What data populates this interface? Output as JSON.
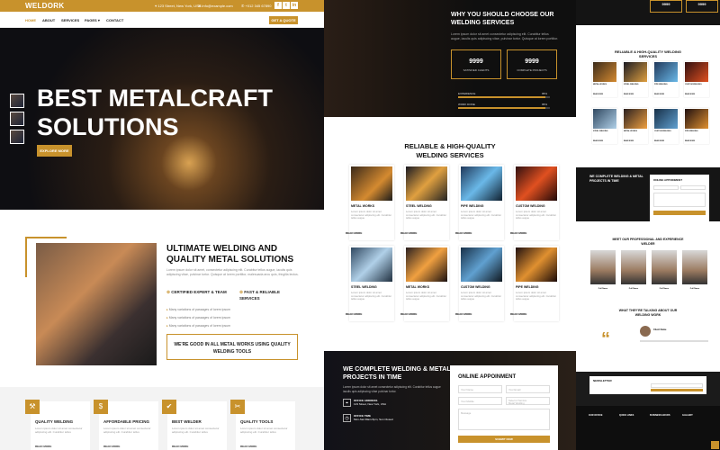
{
  "brand": {
    "name": "WELDORK",
    "accent": "#c8922c"
  },
  "topbar": {
    "address": "123 Street, New York, USA",
    "email": "info@example.com",
    "phone": "+012 345 67890",
    "social": [
      "f",
      "t",
      "in"
    ]
  },
  "nav": {
    "items": [
      "HOME",
      "ABOUT",
      "SERVICES",
      "PAGES",
      "CONTACT"
    ],
    "quote": "GET A QUOTE"
  },
  "hero": {
    "title": "BEST METALCRAFT SOLUTIONS",
    "button": "EXPLORE MORE"
  },
  "about": {
    "title": "ULTIMATE WELDING AND QUALITY METAL SOLUTIONS",
    "text": "Lorem ipsum dolor sit amet, consectetur adipiscing elit. Curabitur tellus augue, iaculis quis adipiscing vitae, pulvinar tortor. Quisque at lorem porttitor, malesuada arcu quis, fringilla lectus.",
    "features": [
      "CERTIFIED EXPERT & TEAM",
      "FAST & RELIABLE SERVICES"
    ],
    "bullets": [
      "Many variations of passages of lorem ipsum",
      "Many variations of passages of lorem ipsum",
      "Many variations of passages of lorem ipsum"
    ],
    "good": "WE'RE GOOD IN ALL METAL WORKS USING QUALITY WELDING TOOLS"
  },
  "services_strip": [
    {
      "icon": "hammer-icon",
      "glyph": "⚒",
      "title": "QUALITY WELDING",
      "desc": "Lorem ipsum dolor sit amet consectetur adipiscing elit. Curabitur tellus",
      "more": "READ MORE"
    },
    {
      "icon": "dollar-icon",
      "glyph": "$",
      "title": "AFFORDABLE PRICING",
      "desc": "Lorem ipsum dolor sit amet consectetur adipiscing elit. Curabitur tellus",
      "more": "READ MORE"
    },
    {
      "icon": "welder-icon",
      "glyph": "✔",
      "title": "BEST WELDER",
      "desc": "Lorem ipsum dolor sit amet consectetur adipiscing elit. Curabitur tellus",
      "more": "READ MORE"
    },
    {
      "icon": "tools-icon",
      "glyph": "✂",
      "title": "QUALITY TOOLS",
      "desc": "Lorem ipsum dolor sit amet consectetur adipiscing elit. Curabitur tellus",
      "more": "READ MORE"
    }
  ],
  "why": {
    "title": "WHY YOU SHOULD CHOOSE OUR WELDING SERVICES",
    "text": "Lorem ipsum dolor sit amet consectetur adipiscing elit. Curabitur tellus augue, iaculis quis adipiscing vitae, pulvinar tortor. Quisque at lorem porttitor.",
    "stats": [
      {
        "num": "9999",
        "label": "SATISFIED CLIENTS"
      },
      {
        "num": "9999",
        "label": "COMPLETE PROJECTS"
      }
    ],
    "bars": [
      {
        "label": "EXPERIENCE",
        "value": "95%",
        "fraction": 0.95
      },
      {
        "label": "WORK DONE",
        "value": "95%",
        "fraction": 0.95
      }
    ]
  },
  "services": {
    "title": "RELIABLE & HIGH-QUALITY WELDING SERVICES",
    "desc": "Lorem ipsum dolor sit amet consectetur adipiscing elit. Curabitur tellus augue",
    "more": "READ MORE",
    "cards": [
      "METAL WORKS",
      "STEEL WELDING",
      "PIPE WELDING",
      "CUSTOM WELDING",
      "STEEL WELDING",
      "METAL WORKS",
      "CUSTOM WELDING",
      "PIPE WELDING"
    ]
  },
  "projects": {
    "title": "WE COMPLETE WELDING & METAL PROJECTS IN TIME",
    "text": "Lorem ipsum dolor sit amet consectetur adipiscing elit. Curabitur tellus augue iaculis quis adipiscing vitae pulvinar tortor.",
    "office_label": "OFFICE ADDRESS",
    "office": "123 Street, New York, USA",
    "time_label": "OFFICE TIME",
    "time": "Mon-Sat 09am-5pm, Sun Closed"
  },
  "appointment": {
    "title": "ONLINE APPOINMENT",
    "name": "Your Name",
    "email": "Your Email",
    "mobile": "Your Mobile",
    "service": "Select A Service",
    "service_value": "Metal Welding",
    "message": "Message",
    "submit": "SUBMIT NOW"
  },
  "right": {
    "stats": [
      "9999",
      "9999"
    ],
    "services_title": "RELIABLE & HIGH-QUALITY WELDING SERVICES",
    "cards": [
      "METAL WORKS",
      "STEEL WELDING",
      "PIPE WELDING",
      "CUSTOM WELDING",
      "STEEL WELDING",
      "METAL WORKS",
      "CUSTOM WELDING",
      "PIPE WELDING"
    ],
    "more": "READ MORE",
    "projects_title": "WE COMPLETE WELDING & METAL PROJECTS IN TIME",
    "appointment_title": "ONLINE APPOINMENT",
    "team_title": "MEET OUR PROFESSIONAL AND EXPERIENCE WELDER",
    "team": [
      "Full Name",
      "Full Name",
      "Full Name",
      "Full Name"
    ],
    "testimonial_title": "WHAT THEY'RE TALKING ABOUT OUR WELDING WORK",
    "client_name": "Client Name",
    "newsletter": "NEWSLETTER",
    "footer_cols": [
      "OUR OFFICE",
      "QUICK LINKS",
      "BUSINESS HOURS",
      "GALLERY"
    ]
  }
}
